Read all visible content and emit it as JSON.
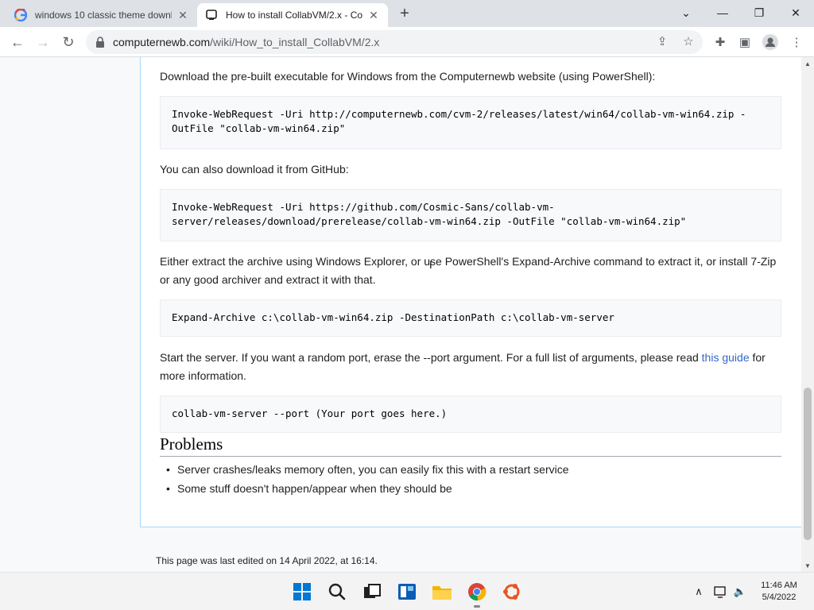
{
  "browser": {
    "tabs": [
      {
        "title": "windows 10 classic theme downl",
        "favicon": "google-g-icon",
        "active": false
      },
      {
        "title": "How to install CollabVM/2.x - Co",
        "favicon": "computernewb-icon",
        "active": true
      }
    ],
    "url_host": "computernewb.com",
    "url_path": "/wiki/How_to_install_CollabVM/2.x"
  },
  "article": {
    "intro_text": "Download the pre-built executable for Windows from the Computernewb website (using PowerShell):",
    "code_1": "Invoke-WebRequest -Uri http://computernewb.com/cvm-2/releases/latest/win64/collab-vm-win64.zip -OutFile \"collab-vm-win64.zip\"",
    "github_text": "You can also download it from GitHub:",
    "code_2": "Invoke-WebRequest -Uri https://github.com/Cosmic-Sans/collab-vm-server/releases/download/prerelease/collab-vm-win64.zip -OutFile \"collab-vm-win64.zip\"",
    "extract_text": "Either extract the archive using Windows Explorer, or use PowerShell's Expand-Archive command to extract it, or install 7-Zip or any good archiver and extract it with that.",
    "code_3": "Expand-Archive c:\\collab-vm-win64.zip -DestinationPath c:\\collab-vm-server",
    "start_text_before": "Start the server. If you want a random port, erase the --port argument. For a full list of arguments, please read ",
    "start_link": "this guide",
    "start_text_after": " for more information.",
    "code_4": "collab-vm-server --port (Your port goes here.)",
    "problems_heading": "Problems",
    "problems": [
      "Server crashes/leaks memory often, you can easily fix this with a restart service",
      "Some stuff doesn't happen/appear when they should be"
    ],
    "footer": "This page was last edited on 14 April 2022, at 16:14."
  },
  "taskbar": {
    "time": "11:46 AM",
    "date": "5/4/2022"
  }
}
